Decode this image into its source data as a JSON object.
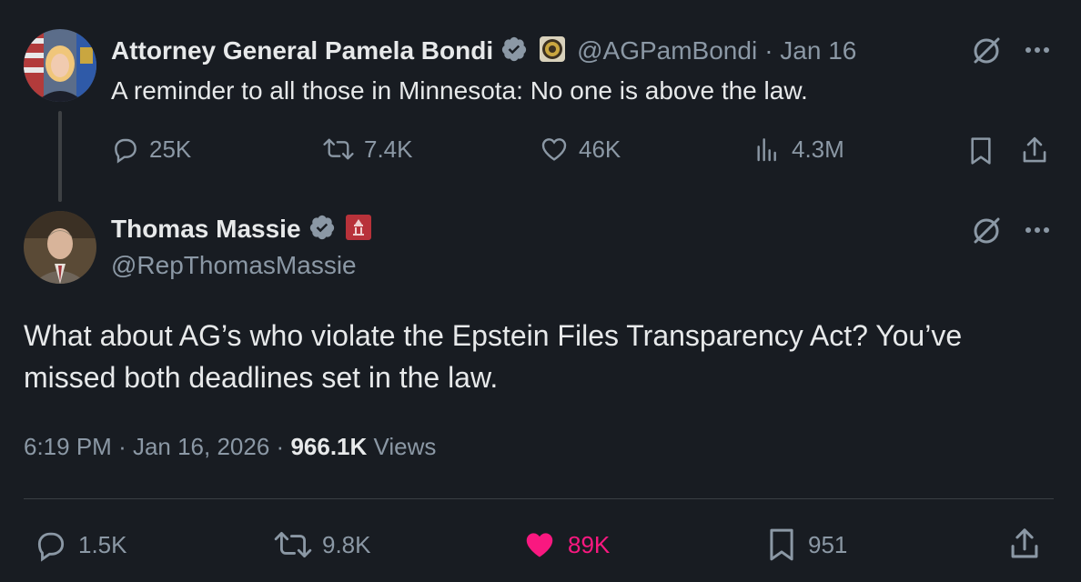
{
  "first_tweet": {
    "author_name": "Attorney General Pamela Bondi",
    "handle": "@AGPamBondi",
    "date": "· Jan 16",
    "text": "A reminder to all those in Minnesota:  No one is above the law.",
    "replies": "25K",
    "reposts": "7.4K",
    "likes": "46K",
    "views": "4.3M"
  },
  "second_tweet": {
    "author_name": "Thomas Massie",
    "handle": "@RepThomasMassie",
    "text": "What about AG’s who violate the Epstein Files Transparency Act? You’ve missed both deadlines set in the law.",
    "time": "6:19 PM",
    "date": "Jan 16, 2026",
    "views_count": "966.1K",
    "views_label": "Views",
    "replies": "1.5K",
    "reposts": "9.8K",
    "likes": "89K",
    "bookmarks": "951"
  },
  "colors": {
    "background": "#181c22",
    "verified_badge": "#8b98a5",
    "like_active": "#f91880"
  },
  "icons": {
    "more": "more-icon",
    "grok": "grok-icon"
  }
}
